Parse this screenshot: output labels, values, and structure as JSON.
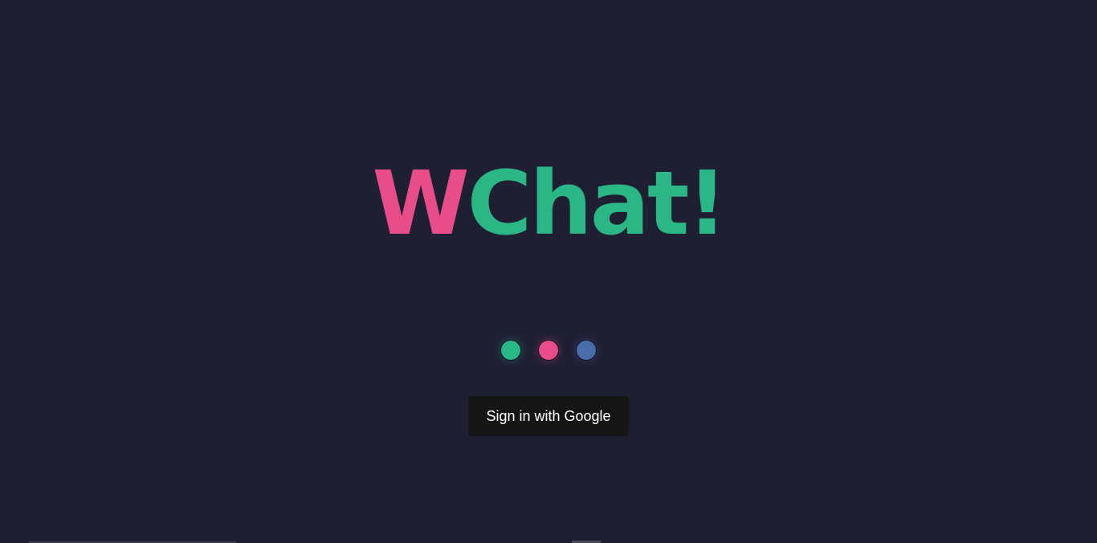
{
  "logo": {
    "part1": "W",
    "part2": "Chat!",
    "colors": {
      "part1": "#e84d8a",
      "part2": "#2bb685"
    }
  },
  "loader": {
    "dots": [
      {
        "color": "#2bb685"
      },
      {
        "color": "#e84d8a"
      },
      {
        "color": "#4b6cab"
      }
    ]
  },
  "signin": {
    "label": "Sign in with Google"
  }
}
